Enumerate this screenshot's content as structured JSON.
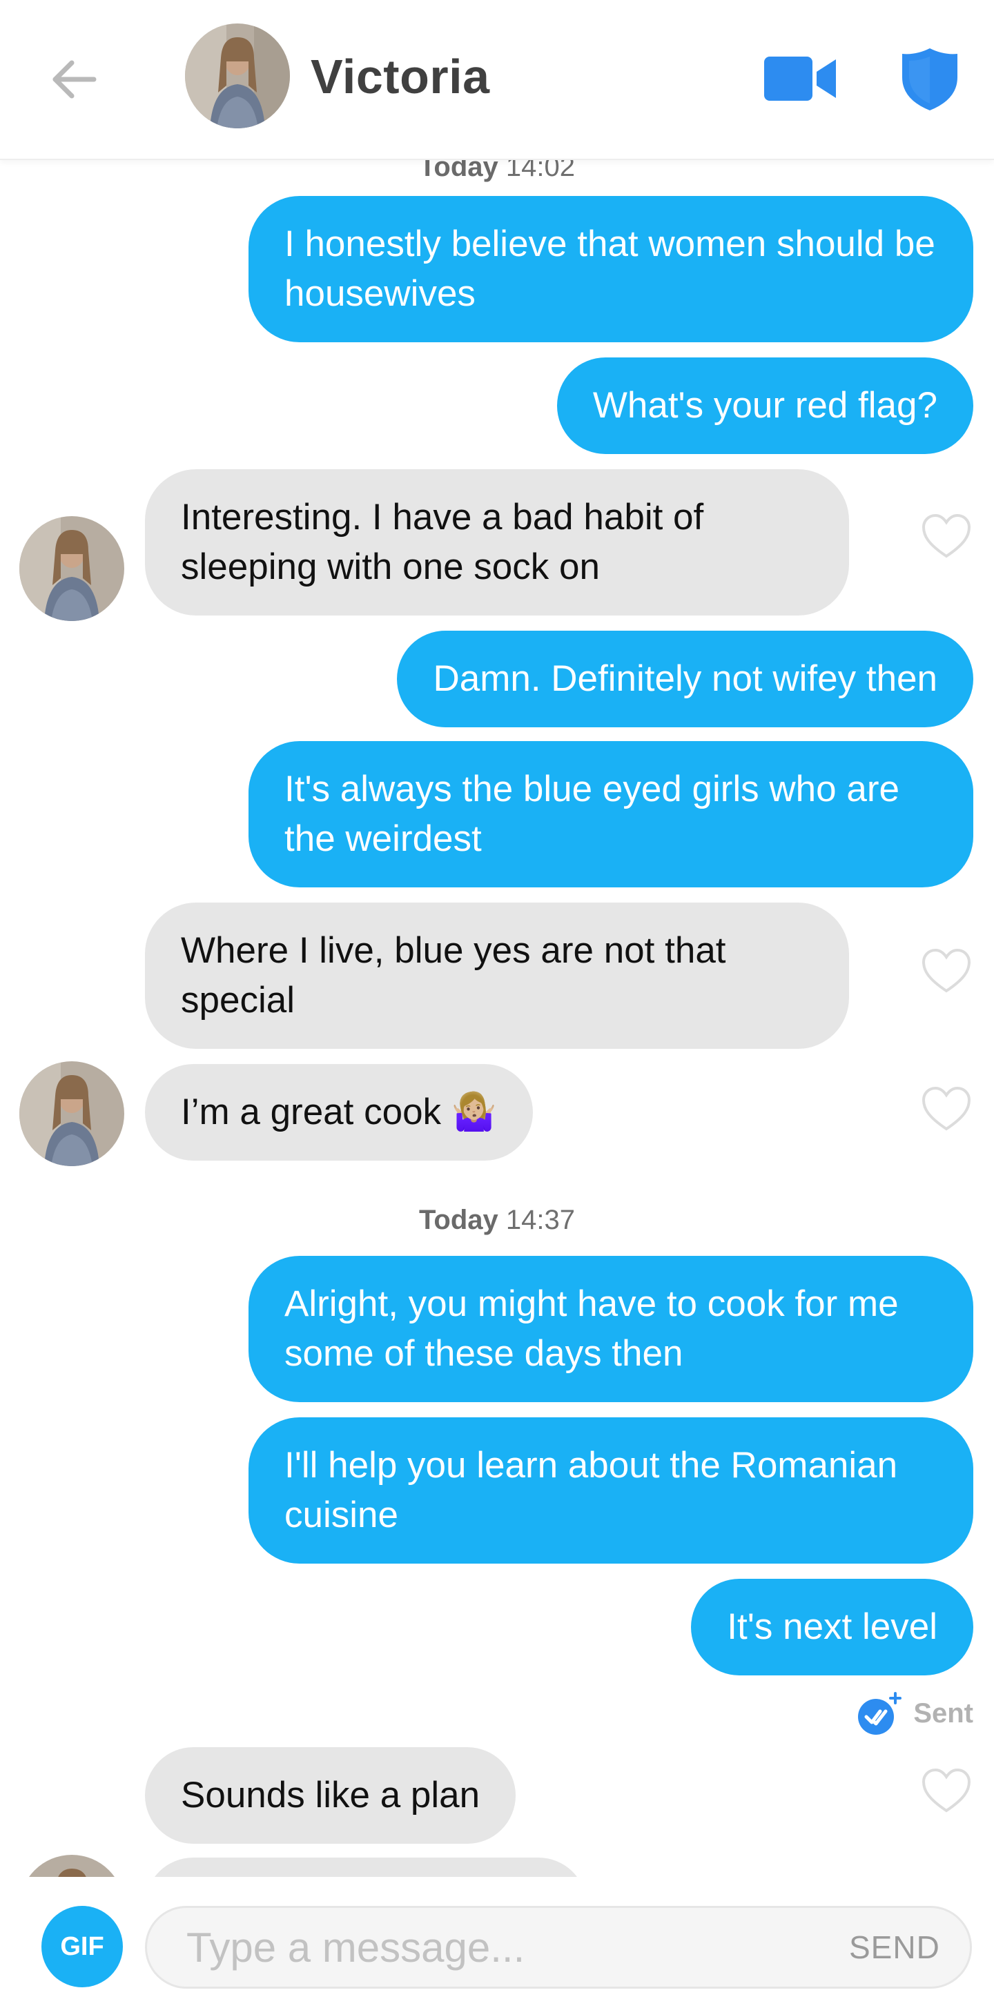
{
  "header": {
    "name": "Victoria",
    "back_icon": "arrow-left-icon",
    "video_icon": "video-camera-icon",
    "shield_icon": "shield-icon",
    "accent": "#2d8cf0"
  },
  "chat": {
    "timestamp_top": {
      "day": "Today",
      "time": "14:02"
    },
    "timestamp_mid": {
      "day": "Today",
      "time": "14:37"
    },
    "messages": [
      {
        "from": "me",
        "text": "I honestly believe that women should be housewives"
      },
      {
        "from": "me",
        "text": "What's your red flag?"
      },
      {
        "from": "them",
        "text": "Interesting. I have a bad habit of sleeping with one sock on"
      },
      {
        "from": "me",
        "text": "Damn. Definitely not wifey then"
      },
      {
        "from": "me",
        "text": "It's always the blue eyed girls who are the weirdest"
      },
      {
        "from": "them",
        "text": "Where I live, blue yes are not that special"
      },
      {
        "from": "them",
        "text": "I’m a great cook",
        "emoji": "🤷🏼‍♀️"
      },
      {
        "from": "me",
        "text": "Alright, you might have to cook for me some of these days then"
      },
      {
        "from": "me",
        "text": "I'll help you learn about the Romanian cuisine"
      },
      {
        "from": "me",
        "text": "It's next level"
      },
      {
        "from": "them",
        "text": "Sounds like a plan"
      }
    ],
    "sent_status": "Sent",
    "colors": {
      "outgoing": "#1ab1f5",
      "incoming": "#e6e6e6"
    }
  },
  "composer": {
    "gif_label": "GIF",
    "placeholder": "Type a message...",
    "send_label": "SEND"
  }
}
